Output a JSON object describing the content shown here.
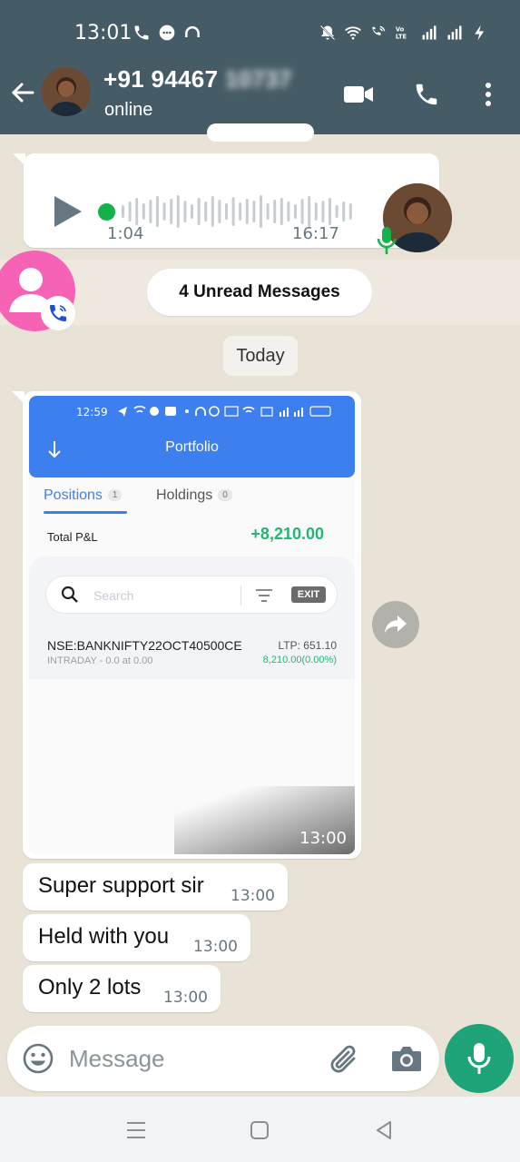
{
  "status_bar": {
    "time": "13:01",
    "left_icons": [
      "phone-icon",
      "chat-bubble-icon",
      "headset-icon"
    ],
    "right_icons": [
      "mute-bell-icon",
      "wifi-icon",
      "wifi-call-icon",
      "volte-icon",
      "signal-icon",
      "signal-icon",
      "charging-icon"
    ]
  },
  "header": {
    "contact_visible": "+91 94467",
    "contact_blurred": "10737",
    "status": "online",
    "actions": [
      "video-call-icon",
      "voice-call-icon",
      "more-options-icon"
    ]
  },
  "voice_message": {
    "duration": "1:04",
    "time": "16:17",
    "played_fraction": 0.0
  },
  "unread_divider": "4 Unread Messages",
  "date_divider": "Today",
  "image_message": {
    "time": "13:00",
    "screenshot": {
      "status_time": "12:59",
      "title": "Portfolio",
      "tabs": [
        {
          "label": "Positions",
          "count": "1"
        },
        {
          "label": "Holdings",
          "count": "0"
        }
      ],
      "total_pnl_label": "Total P&L",
      "total_pnl_value": "+8,210.00",
      "search_placeholder": "Search",
      "exit_label": "EXIT",
      "position": {
        "symbol": "NSE:BANKNIFTY22OCT40500CE",
        "sub": "INTRADAY -  0.0 at 0.00",
        "ltp": "LTP: 651.10",
        "change": "8,210.00(0.00%)"
      }
    }
  },
  "text_messages": [
    {
      "text": "Super support sir",
      "time": "13:00"
    },
    {
      "text": "Held with you",
      "time": "13:00"
    },
    {
      "text": "Only 2 lots",
      "time": "13:00"
    }
  ],
  "composer": {
    "placeholder": "Message"
  },
  "colors": {
    "header": "#455b66",
    "chat_bg": "#e9e2d7",
    "accent": "#1fa47a",
    "voice_dot": "#14b24a",
    "app_blue": "#3d7fef",
    "profit_green": "#22b573",
    "missed_call_avatar": "#f763b4"
  }
}
